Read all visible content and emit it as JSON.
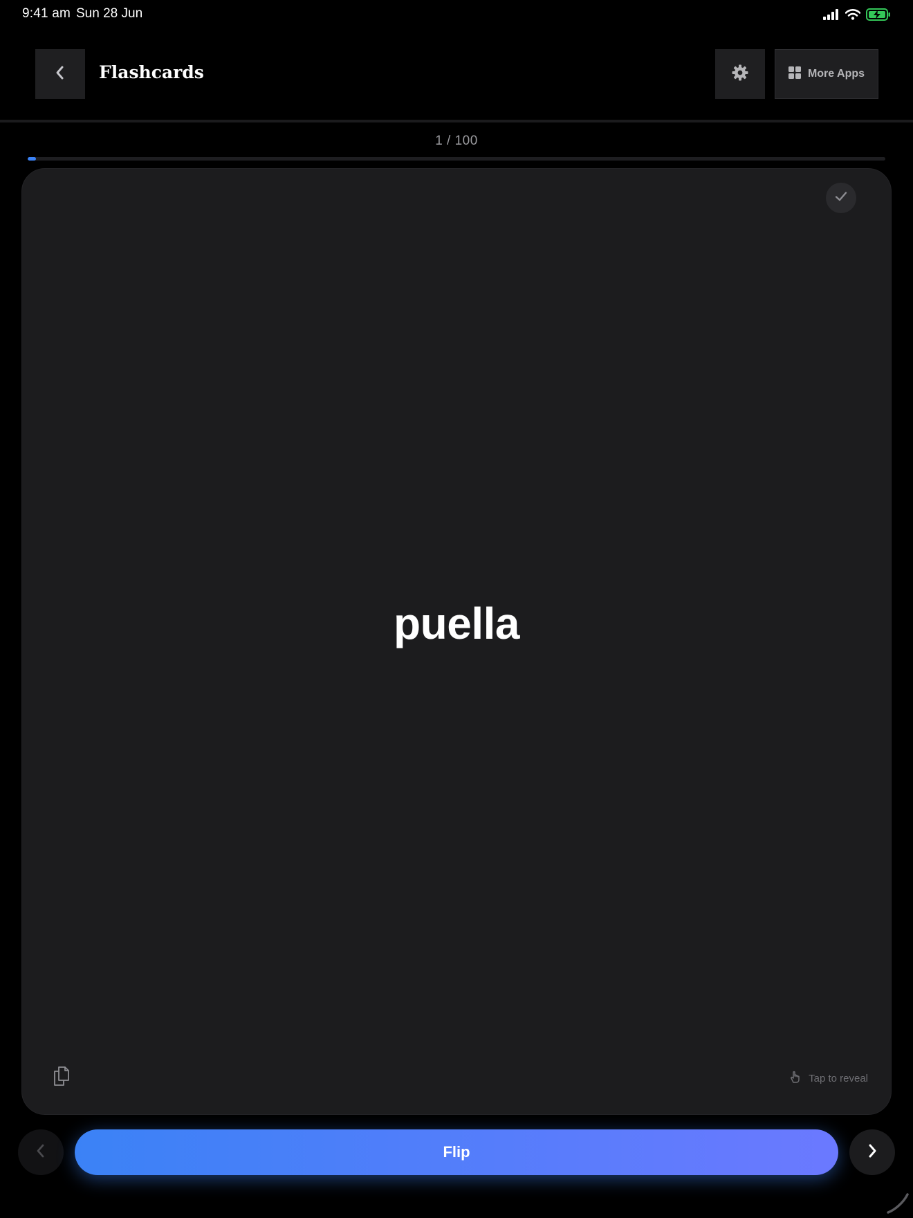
{
  "status_bar": {
    "time": "9:41 am",
    "date": "Sun 28 Jun",
    "icons": [
      "cellular-signal-icon",
      "wifi-icon",
      "battery-charging-icon"
    ]
  },
  "header": {
    "title": "Flashcards",
    "back_icon": "chevron-left-icon",
    "settings_icon": "gear-icon",
    "more_apps_label": "More Apps",
    "more_apps_icon": "grid-icon"
  },
  "progress": {
    "label": "1 / 100",
    "current": 1,
    "total": 100,
    "fill_fraction": 0.01,
    "accent_color": "#3b82f6"
  },
  "card": {
    "word": "puella",
    "known_icon": "check-icon",
    "copy_icon": "copy-icon",
    "tap_hint_label": "Tap to reveal",
    "tap_hint_icon": "tap-hand-icon"
  },
  "controls": {
    "flip_label": "Flip",
    "prev_icon": "chevron-left-icon",
    "next_icon": "chevron-right-icon",
    "flip_gradient": [
      "#3b82f6",
      "#6b79ff"
    ]
  }
}
